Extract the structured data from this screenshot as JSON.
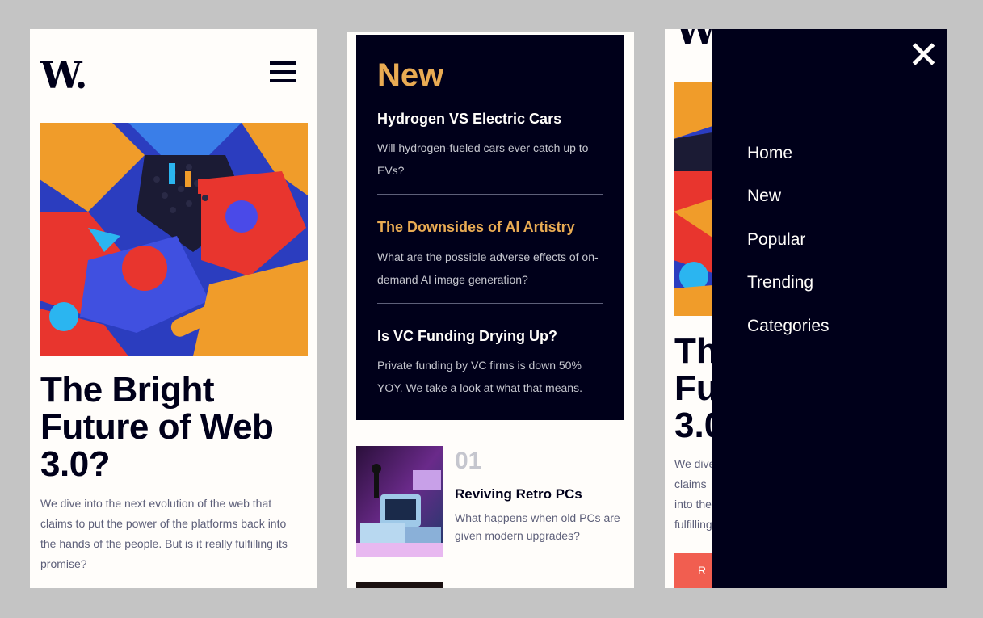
{
  "logo": "W.",
  "hero": {
    "title": "The Bright Future of Web 3.0?",
    "description": "We dive into the next evolution of the web that claims to put the power of the platforms back into the hands of the people. But is it really fulfilling its promise?",
    "title_partial_lines": [
      "Th",
      "Fu",
      "3.0"
    ],
    "description_partial_lines": [
      "We dive",
      "claims",
      "into the",
      "fulfilling"
    ]
  },
  "new_section": {
    "heading": "New",
    "articles": [
      {
        "title": "Hydrogen VS Electric Cars",
        "description": "Will hydrogen-fueled cars ever catch up to EVs?",
        "highlighted": false
      },
      {
        "title": "The Downsides of AI Artistry",
        "description": "What are the possible adverse effects of on-demand AI image generation?",
        "highlighted": true
      },
      {
        "title": "Is VC Funding Drying Up?",
        "description": "Private funding by VC firms is down 50% YOY. We take a look at what that means.",
        "highlighted": false
      }
    ]
  },
  "numbered_list": [
    {
      "number": "01",
      "title": "Reviving Retro PCs",
      "description": "What happens when old PCs are given modern upgrades?"
    }
  ],
  "menu": {
    "items": [
      "Home",
      "New",
      "Popular",
      "Trending",
      "Categories"
    ]
  },
  "read_more_partial": "R E",
  "icons": {
    "menu": "hamburger-icon",
    "close": "close-icon"
  },
  "colors": {
    "dark_navy": "#00001a",
    "off_white": "#fffdfa",
    "orange": "#e9ab53",
    "red": "#f15e50",
    "grayish_blue": "#5d5f79",
    "light_gray": "#c5c6ce"
  }
}
